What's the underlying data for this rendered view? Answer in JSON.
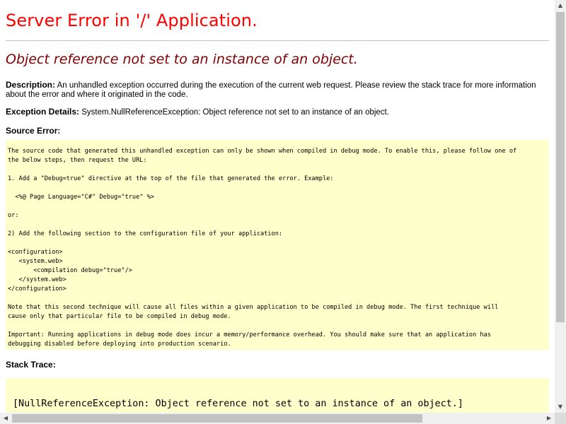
{
  "page": {
    "title": "Server Error in '/' Application.",
    "subtitle": "Object reference not set to an instance of an object.",
    "description_label": "Description:",
    "description_text": " An unhandled exception occurred during the execution of the current web request. Please review the stack trace for more information about the error and where it originated in the code.",
    "exception_label": "Exception Details:",
    "exception_text": " System.NullReferenceException: Object reference not set to an instance of an object.",
    "source_error_label": "Source Error:",
    "source_error_body": "The source code that generated this unhandled exception can only be shown when compiled in debug mode. To enable this, please follow one of\nthe below steps, then request the URL:\n\n1. Add a \"Debug=true\" directive at the top of the file that generated the error. Example:\n\n  <%@ Page Language=\"C#\" Debug=\"true\" %>\n\nor:\n\n2) Add the following section to the configuration file of your application:\n\n<configuration>\n   <system.web>\n       <compilation debug=\"true\"/>\n   </system.web>\n</configuration>\n\nNote that this second technique will cause all files within a given application to be compiled in debug mode. The first technique will\ncause only that particular file to be compiled in debug mode.\n\nImportant: Running applications in debug mode does incur a memory/performance overhead. You should make sure that an application has\ndebugging disabled before deploying into production scenario.",
    "stack_trace_label": "Stack Trace:",
    "stack_trace_body": "[NullReferenceException: Object reference not set to an instance of an object.]"
  },
  "icons": {
    "scroll_up": "scroll-up-arrow-icon",
    "scroll_down": "scroll-down-arrow-icon",
    "scroll_left": "scroll-left-arrow-icon",
    "scroll_right": "scroll-right-arrow-icon"
  },
  "colors": {
    "title": "#ff0000",
    "subtitle": "#800000",
    "code_background": "#ffffcc"
  }
}
